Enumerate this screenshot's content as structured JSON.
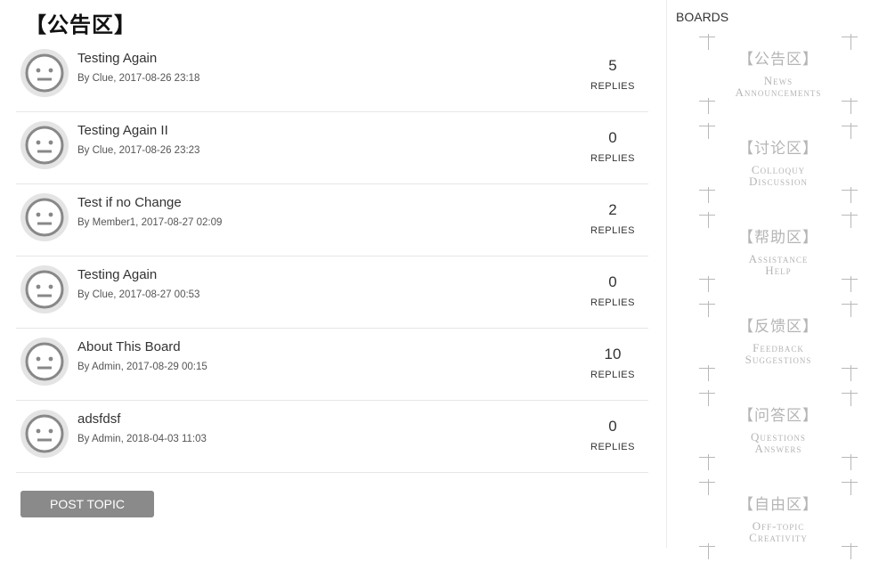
{
  "board": {
    "title": "【公告区】"
  },
  "topics": [
    {
      "title": "Testing Again",
      "meta": "By Clue, 2017-08-26 23:18",
      "replies": "5",
      "replies_label": "REPLIES"
    },
    {
      "title": "Testing Again II",
      "meta": "By Clue, 2017-08-26 23:23",
      "replies": "0",
      "replies_label": "REPLIES"
    },
    {
      "title": "Test if no Change",
      "meta": "By Member1, 2017-08-27 02:09",
      "replies": "2",
      "replies_label": "REPLIES"
    },
    {
      "title": "Testing Again",
      "meta": "By Clue, 2017-08-27 00:53",
      "replies": "0",
      "replies_label": "REPLIES"
    },
    {
      "title": "About This Board",
      "meta": "By Admin, 2017-08-29 00:15",
      "replies": "10",
      "replies_label": "REPLIES"
    },
    {
      "title": "adsfdsf",
      "meta": "By Admin, 2018-04-03 11:03",
      "replies": "0",
      "replies_label": "REPLIES"
    }
  ],
  "actions": {
    "post_topic_label": "POST TOPIC"
  },
  "sidebar": {
    "heading": "BOARDS",
    "boards": [
      {
        "cn": "【公告区】",
        "en1": "News",
        "en2": "Announcements"
      },
      {
        "cn": "【讨论区】",
        "en1": "Colloquy",
        "en2": "Discussion"
      },
      {
        "cn": "【帮助区】",
        "en1": "Assistance",
        "en2": "Help"
      },
      {
        "cn": "【反馈区】",
        "en1": "Feedback",
        "en2": "Suggestions"
      },
      {
        "cn": "【问答区】",
        "en1": "Questions",
        "en2": "Answers"
      },
      {
        "cn": "【自由区】",
        "en1": "Off-topic",
        "en2": "Creativity"
      }
    ]
  },
  "icons": {
    "avatar": "default-avatar-face-icon",
    "board_corner": "corner-cross-icon"
  },
  "colors": {
    "button_bg": "#8a8a8a",
    "sidebar_text": "#b5b5b5",
    "avatar_bg": "#e4e4e4"
  }
}
